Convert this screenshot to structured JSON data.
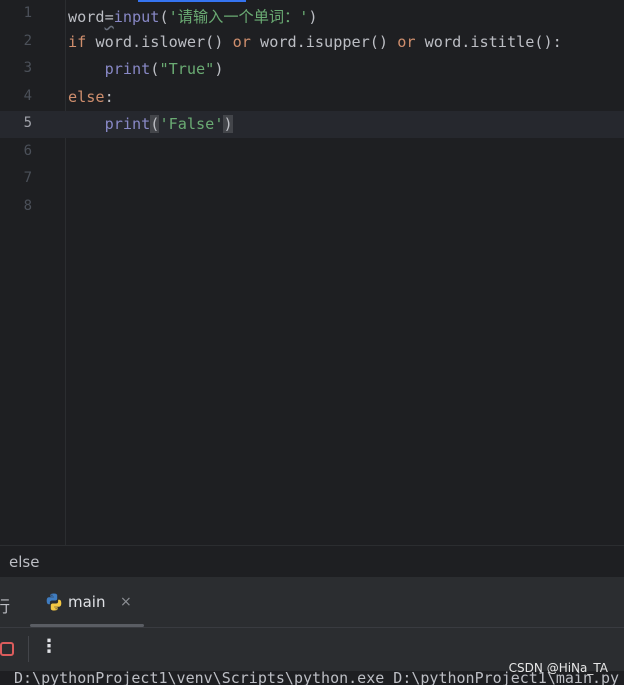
{
  "editor": {
    "current_line": 5,
    "lines": [
      {
        "num": "1",
        "tokens": [
          {
            "t": "word",
            "c": "plain"
          },
          {
            "t": "=",
            "c": "plain sq"
          },
          {
            "t": "input",
            "c": "fn"
          },
          {
            "t": "(",
            "c": "plain"
          },
          {
            "t": "'请输入一个单词：'",
            "c": "str"
          },
          {
            "t": ")",
            "c": "plain"
          }
        ]
      },
      {
        "num": "2",
        "tokens": [
          {
            "t": "if",
            "c": "kw"
          },
          {
            "t": " word.islower() ",
            "c": "plain"
          },
          {
            "t": "or",
            "c": "kw"
          },
          {
            "t": " word.isupper() ",
            "c": "plain"
          },
          {
            "t": "or",
            "c": "kw"
          },
          {
            "t": " word.istitle():",
            "c": "plain"
          }
        ]
      },
      {
        "num": "3",
        "tokens": [
          {
            "t": "    ",
            "c": "plain"
          },
          {
            "t": "print",
            "c": "fn"
          },
          {
            "t": "(",
            "c": "plain"
          },
          {
            "t": "\"True\"",
            "c": "str"
          },
          {
            "t": ")",
            "c": "plain"
          }
        ]
      },
      {
        "num": "4",
        "tokens": [
          {
            "t": "else",
            "c": "kw"
          },
          {
            "t": ":",
            "c": "plain"
          }
        ]
      },
      {
        "num": "5",
        "tokens": [
          {
            "t": "    ",
            "c": "plain"
          },
          {
            "t": "print",
            "c": "fn"
          },
          {
            "t": "(",
            "c": "plain brmatch"
          },
          {
            "t": "'False'",
            "c": "str"
          },
          {
            "t": ")",
            "c": "plain brmatch"
          }
        ]
      },
      {
        "num": "6",
        "tokens": []
      },
      {
        "num": "7",
        "tokens": []
      },
      {
        "num": "8",
        "tokens": []
      }
    ]
  },
  "breadcrumb": {
    "label": "else"
  },
  "run_panel": {
    "prev_tab_label": "行",
    "tab_label": "main",
    "close_glyph": "×",
    "more_glyph": "⋮",
    "console_text": "D:\\pythonProject1\\venv\\Scripts\\python.exe D:\\pythonProject1\\main.py"
  },
  "watermark": "CSDN @HiNa_TA",
  "colors": {
    "background": "#1e1f22",
    "keyword": "#cf8e6d",
    "builtin": "#8888c6",
    "string": "#6aab73",
    "stop": "#db5c5c"
  }
}
